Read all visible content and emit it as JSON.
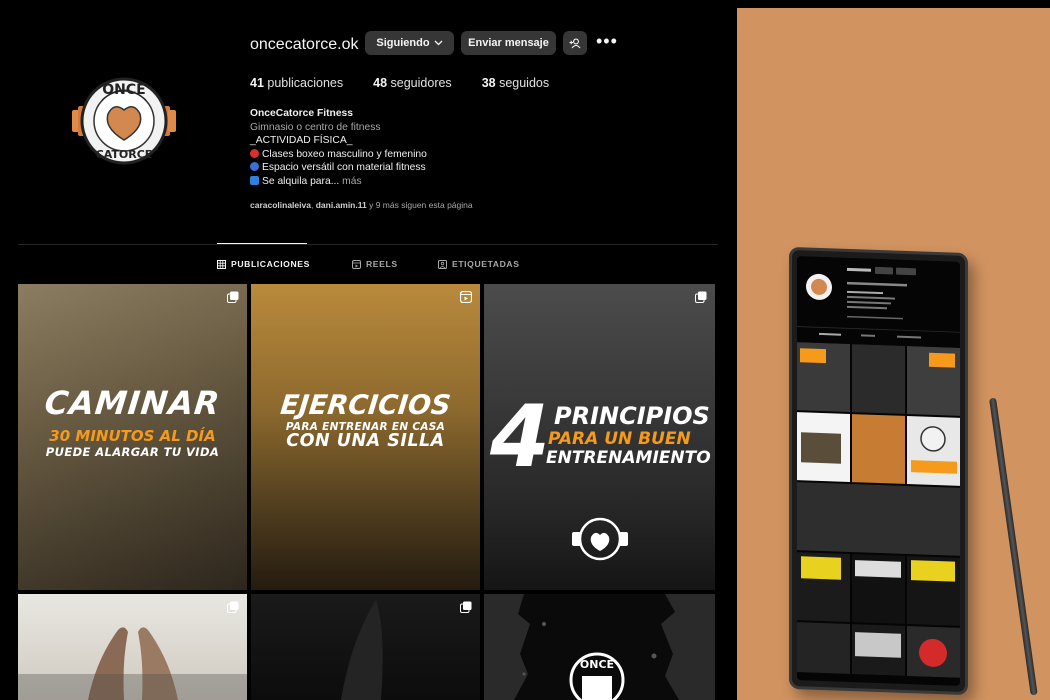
{
  "profile": {
    "username": "oncecatorce.ok",
    "follow_button": "Siguiendo",
    "message_button": "Enviar mensaje",
    "more_icon": "more-horizontal-icon",
    "stats": {
      "posts_count": "41",
      "posts_label": "publicaciones",
      "followers_count": "48",
      "followers_label": "seguidores",
      "following_count": "38",
      "following_label": "seguidos"
    },
    "bio": {
      "name": "OnceCatorce Fitness",
      "category": "Gimnasio o centro de fitness",
      "line1": "_ACTIVIDAD FÍSICA_",
      "line2": "Clases boxeo masculino y femenino",
      "line3": "Espacio versátil con material fitness",
      "line4": "Se alquila para...",
      "more": "más"
    },
    "followed_by": {
      "user1": "caracolinaleiva",
      "user2": "dani.amin.11",
      "rest": "y 9 más siguen esta página"
    },
    "logo_text_top": "ONCE",
    "logo_text_bottom": "CATORCE"
  },
  "tabs": [
    {
      "label": "PUBLICACIONES",
      "icon": "grid-icon",
      "active": true
    },
    {
      "label": "REELS",
      "icon": "reels-icon",
      "active": false
    },
    {
      "label": "ETIQUETADAS",
      "icon": "tagged-icon",
      "active": false
    }
  ],
  "posts": {
    "p1": {
      "title": "CAMINAR",
      "sub1": "30 MINUTOS AL DÍA",
      "sub2": "PUEDE ALARGAR TU VIDA",
      "icon": "carousel-icon"
    },
    "p2": {
      "title": "EJERCICIOS",
      "sub1": "PARA ENTRENAR EN CASA",
      "sub2": "CON UNA SILLA",
      "icon": "reel-icon"
    },
    "p3": {
      "number": "4",
      "l1": "PRINCIPIOS",
      "l2": "PARA UN BUEN",
      "l3": "ENTRENAMIENTO",
      "icon": "carousel-icon"
    },
    "p4": {
      "icon": "carousel-icon"
    },
    "p5": {
      "icon": "carousel-icon"
    },
    "p6": {
      "icon": "reel-icon"
    }
  },
  "colors": {
    "accent_orange": "#f59a1a",
    "promo_bg": "#d19360",
    "button_bg": "#363636"
  }
}
